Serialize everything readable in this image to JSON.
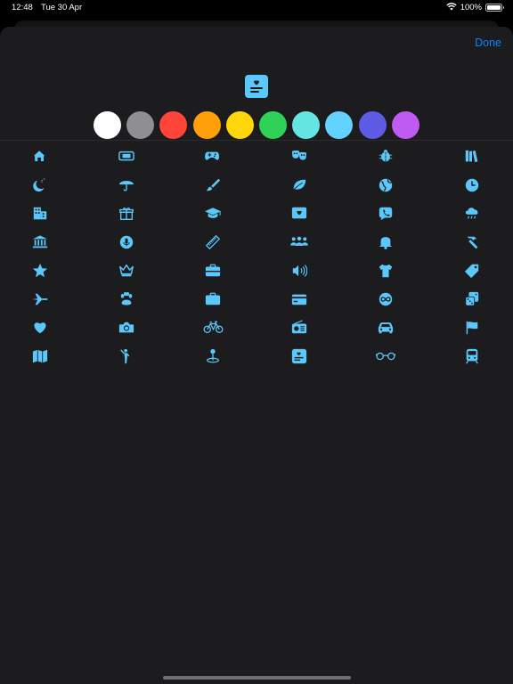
{
  "status_bar": {
    "time": "12:48",
    "date": "Tue 30 Apr",
    "battery": "100%",
    "battery_level": 1.0
  },
  "sheet": {
    "done_label": "Done"
  },
  "selected_icon": "id-card-heart-icon",
  "accent_color": "#5ac8fa",
  "colors": [
    {
      "name": "white",
      "hex": "#ffffff"
    },
    {
      "name": "gray",
      "hex": "#8e8e93"
    },
    {
      "name": "red",
      "hex": "#ff453a"
    },
    {
      "name": "orange",
      "hex": "#ff9f0a"
    },
    {
      "name": "yellow",
      "hex": "#ffd60a"
    },
    {
      "name": "green",
      "hex": "#30d158"
    },
    {
      "name": "mint",
      "hex": "#63e6e2"
    },
    {
      "name": "light-blue",
      "hex": "#64d2ff"
    },
    {
      "name": "indigo",
      "hex": "#5e5ce6"
    },
    {
      "name": "purple",
      "hex": "#bf5af2"
    }
  ],
  "icons": [
    [
      "house",
      "gamecontroller-handheld",
      "gamecontroller",
      "theatermasks",
      "ladybug",
      "books"
    ],
    [
      "moon-zzz",
      "umbrella",
      "paintbrush",
      "leaf",
      "globe",
      "clock"
    ],
    [
      "building",
      "gift",
      "graduationcap",
      "heart-tv",
      "phone-bubble",
      "cloud-rain"
    ],
    [
      "bank",
      "mic-circle",
      "comb",
      "people",
      "bell",
      "hammer"
    ],
    [
      "star",
      "crown",
      "briefcase-medical",
      "speaker-wave",
      "tshirt",
      "tag"
    ],
    [
      "airplane",
      "pawprint",
      "briefcase",
      "creditcard",
      "infinity",
      "dice"
    ],
    [
      "heart",
      "camera",
      "bicycle",
      "radio",
      "car",
      "flag"
    ],
    [
      "map",
      "figure-wave",
      "pin",
      "id-card",
      "eyeglasses",
      "tram"
    ]
  ]
}
